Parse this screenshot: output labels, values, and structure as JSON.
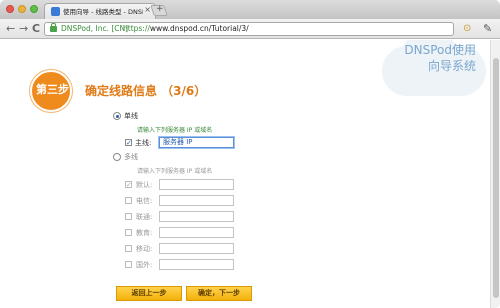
{
  "browser": {
    "tab_title": "使用向导 - 线路类型 - DNSPod",
    "tab_close": "×",
    "new_tab": "+",
    "back": "←",
    "forward": "→",
    "reload": "C",
    "ev_label": "DNSPod, Inc. [CN]",
    "url_scheme": "https://",
    "url_rest": "www.dnspod.cn/Tutorial/3/",
    "rss_icon": "rss-icon",
    "wrench_icon": "wrench-icon"
  },
  "brand": {
    "line1": "DNSPod使用",
    "line2": "向导系统"
  },
  "step": {
    "badge": "第三步",
    "title": "确定线路信息 （3/6）"
  },
  "form": {
    "single_line": "单线",
    "single_hint": "请输入下列服务器 IP 或域名",
    "main_label": "主线:",
    "main_value": "服务器 IP",
    "multi_line": "多线",
    "multi_hint": "请输入下列服务器 IP 或域名",
    "rows": [
      {
        "label": "默认:",
        "checked": true
      },
      {
        "label": "电信:",
        "checked": false
      },
      {
        "label": "联通:",
        "checked": false
      },
      {
        "label": "教育:",
        "checked": false
      },
      {
        "label": "移动:",
        "checked": false
      },
      {
        "label": "国外:",
        "checked": false
      }
    ]
  },
  "buttons": {
    "back": "返回上一步",
    "next": "确定，下一步"
  },
  "colors": {
    "accent": "#ef8a1c",
    "button": "#f3b10c",
    "brand": "#7aa7cf"
  }
}
